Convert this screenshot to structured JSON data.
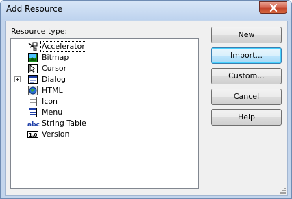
{
  "window": {
    "title": "Add Resource"
  },
  "labels": {
    "resource_type": "Resource type:"
  },
  "tree": {
    "items": [
      {
        "label": "Accelerator",
        "icon": "accelerator-icon",
        "selected": true,
        "expandable": false
      },
      {
        "label": "Bitmap",
        "icon": "bitmap-icon",
        "selected": false,
        "expandable": false
      },
      {
        "label": "Cursor",
        "icon": "cursor-icon",
        "selected": false,
        "expandable": false
      },
      {
        "label": "Dialog",
        "icon": "dialog-icon",
        "selected": false,
        "expandable": true
      },
      {
        "label": "HTML",
        "icon": "html-icon",
        "selected": false,
        "expandable": false
      },
      {
        "label": "Icon",
        "icon": "icon-resource-icon",
        "selected": false,
        "expandable": false
      },
      {
        "label": "Menu",
        "icon": "menu-icon",
        "selected": false,
        "expandable": false
      },
      {
        "label": "String Table",
        "icon": "string-table-icon",
        "selected": false,
        "expandable": false
      },
      {
        "label": "Version",
        "icon": "version-icon",
        "selected": false,
        "expandable": false
      }
    ]
  },
  "buttons": {
    "new": "New",
    "import": "Import...",
    "custom": "Custom...",
    "cancel": "Cancel",
    "help": "Help"
  },
  "colors": {
    "frame": "#c3d5ec",
    "client": "#f0f0f0",
    "close_red": "#c0402a",
    "focus_blue": "#3c7fb1"
  }
}
